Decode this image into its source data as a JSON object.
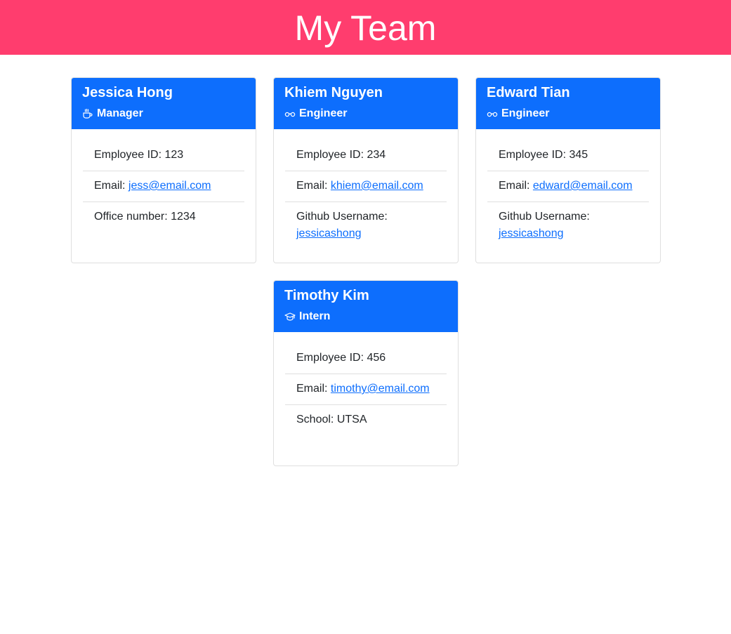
{
  "header": {
    "title": "My Team"
  },
  "labels": {
    "employee_id": "Employee ID: ",
    "email": "Email: ",
    "office": "Office number: ",
    "github": "Github Username: ",
    "school": "School: "
  },
  "colors": {
    "header_bg": "#ff3d6e",
    "card_head_bg": "#0d6efd",
    "link": "#0d6efd"
  },
  "employees": [
    {
      "name": "Jessica Hong",
      "role": "Manager",
      "icon": "coffee-cup-icon",
      "id": "123",
      "email": "jess@email.com",
      "extra": "1234"
    },
    {
      "name": "Khiem Nguyen",
      "role": "Engineer",
      "icon": "glasses-icon",
      "id": "234",
      "email": "khiem@email.com",
      "extra": "jessicashong"
    },
    {
      "name": "Edward Tian",
      "role": "Engineer",
      "icon": "glasses-icon",
      "id": "345",
      "email": "edward@email.com",
      "extra": "jessicashong"
    },
    {
      "name": "Timothy Kim",
      "role": "Intern",
      "icon": "graduation-cap-icon",
      "id": "456",
      "email": "timothy@email.com",
      "extra": "UTSA"
    }
  ]
}
